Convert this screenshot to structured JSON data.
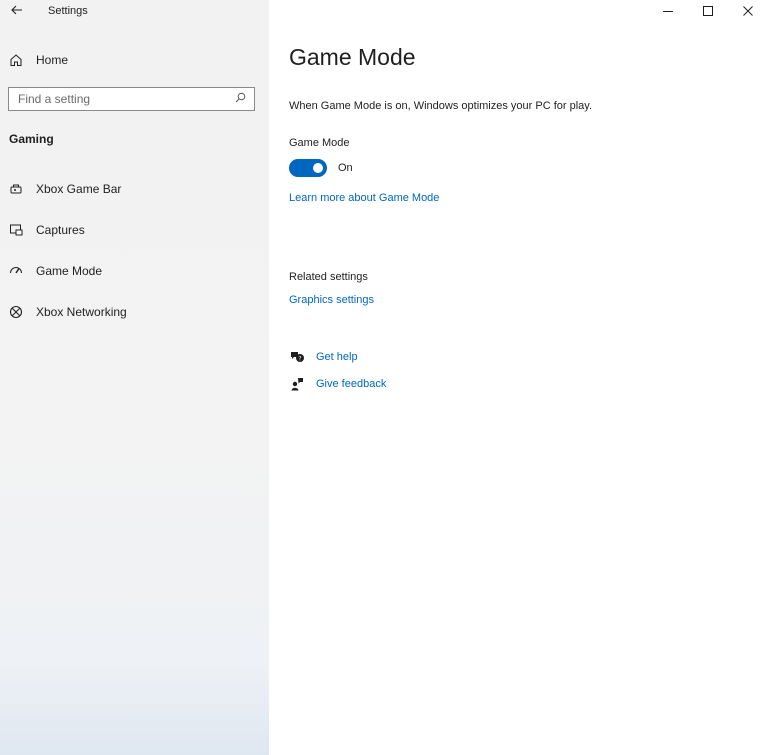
{
  "window": {
    "title": "Settings",
    "controls": {
      "minimize": "—",
      "maximize": "☐",
      "close": "✕"
    }
  },
  "sidebar": {
    "home_label": "Home",
    "search": {
      "placeholder": "Find a setting",
      "value": ""
    },
    "section_title": "Gaming",
    "items": [
      {
        "label": "Xbox Game Bar",
        "icon": "xbox-game-bar-icon"
      },
      {
        "label": "Captures",
        "icon": "captures-icon"
      },
      {
        "label": "Game Mode",
        "icon": "game-mode-icon"
      },
      {
        "label": "Xbox Networking",
        "icon": "xbox-icon"
      }
    ]
  },
  "main": {
    "title": "Game Mode",
    "description": "When Game Mode is on, Windows optimizes your PC for play.",
    "setting": {
      "label": "Game Mode",
      "state": "On",
      "enabled": true
    },
    "learn_more": "Learn more about Game Mode",
    "related": {
      "title": "Related settings",
      "graphics_link": "Graphics settings"
    },
    "help": {
      "get_help": "Get help",
      "give_feedback": "Give feedback"
    }
  },
  "colors": {
    "accent": "#0067c0",
    "sidebar_bg": "#f2f2f2",
    "text": "#1f1f1f"
  }
}
